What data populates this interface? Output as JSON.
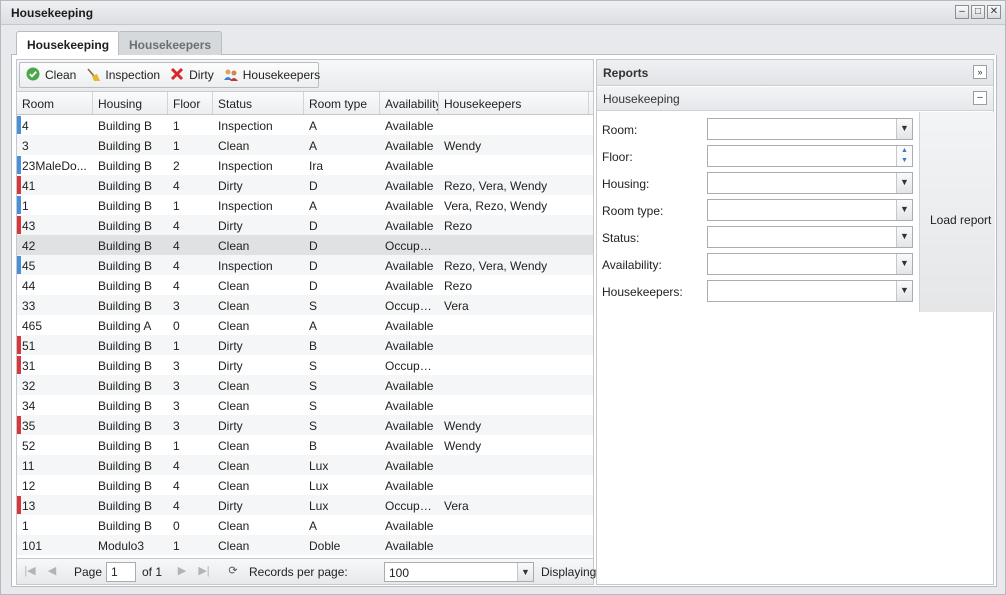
{
  "window": {
    "title": "Housekeeping",
    "buttons": [
      "–",
      "□",
      "✕"
    ]
  },
  "tabs": [
    {
      "label": "Housekeeping",
      "active": true
    },
    {
      "label": "Housekeepers",
      "active": false
    }
  ],
  "toolbar": {
    "clean": "Clean",
    "inspection": "Inspection",
    "dirty": "Dirty",
    "housekeepers": "Housekeepers"
  },
  "grid": {
    "columns": [
      "Room",
      "Housing",
      "Floor",
      "Status",
      "Room type",
      "Availability",
      "Housekeepers"
    ],
    "rows": [
      {
        "room": "4",
        "housing": "Building B",
        "floor": "1",
        "status": "Inspection",
        "type": "A",
        "avail": "Available",
        "hk": "",
        "marker": "#4a90d9"
      },
      {
        "room": "3",
        "housing": "Building B",
        "floor": "1",
        "status": "Clean",
        "type": "A",
        "avail": "Available",
        "hk": "Wendy",
        "marker": ""
      },
      {
        "room": "23MaleDo...",
        "housing": "Building B",
        "floor": "2",
        "status": "Inspection",
        "type": "Ira",
        "avail": "Available",
        "hk": "",
        "marker": "#4a90d9"
      },
      {
        "room": "41",
        "housing": "Building B",
        "floor": "4",
        "status": "Dirty",
        "type": "D",
        "avail": "Available",
        "hk": "Rezo, Vera, Wendy",
        "marker": "#d9363e"
      },
      {
        "room": "1",
        "housing": "Building B",
        "floor": "1",
        "status": "Inspection",
        "type": "A",
        "avail": "Available",
        "hk": "Vera, Rezo, Wendy",
        "marker": "#4a90d9"
      },
      {
        "room": "43",
        "housing": "Building B",
        "floor": "4",
        "status": "Dirty",
        "type": "D",
        "avail": "Available",
        "hk": "Rezo",
        "marker": "#d9363e"
      },
      {
        "room": "42",
        "housing": "Building B",
        "floor": "4",
        "status": "Clean",
        "type": "D",
        "avail": "Occupied",
        "hk": "",
        "marker": "",
        "selected": true
      },
      {
        "room": "45",
        "housing": "Building B",
        "floor": "4",
        "status": "Inspection",
        "type": "D",
        "avail": "Available",
        "hk": "Rezo, Vera, Wendy",
        "marker": "#4a90d9"
      },
      {
        "room": "44",
        "housing": "Building B",
        "floor": "4",
        "status": "Clean",
        "type": "D",
        "avail": "Available",
        "hk": "Rezo",
        "marker": ""
      },
      {
        "room": "33",
        "housing": "Building B",
        "floor": "3",
        "status": "Clean",
        "type": "S",
        "avail": "Occupied",
        "hk": "Vera",
        "marker": ""
      },
      {
        "room": "465",
        "housing": "Building A",
        "floor": "0",
        "status": "Clean",
        "type": "A",
        "avail": "Available",
        "hk": "",
        "marker": ""
      },
      {
        "room": "51",
        "housing": "Building B",
        "floor": "1",
        "status": "Dirty",
        "type": "B",
        "avail": "Available",
        "hk": "",
        "marker": "#d9363e"
      },
      {
        "room": "31",
        "housing": "Building B",
        "floor": "3",
        "status": "Dirty",
        "type": "S",
        "avail": "Occupied",
        "hk": "",
        "marker": "#d9363e"
      },
      {
        "room": "32",
        "housing": "Building B",
        "floor": "3",
        "status": "Clean",
        "type": "S",
        "avail": "Available",
        "hk": "",
        "marker": ""
      },
      {
        "room": "34",
        "housing": "Building B",
        "floor": "3",
        "status": "Clean",
        "type": "S",
        "avail": "Available",
        "hk": "",
        "marker": ""
      },
      {
        "room": "35",
        "housing": "Building B",
        "floor": "3",
        "status": "Dirty",
        "type": "S",
        "avail": "Available",
        "hk": "Wendy",
        "marker": "#d9363e"
      },
      {
        "room": "52",
        "housing": "Building B",
        "floor": "1",
        "status": "Clean",
        "type": "B",
        "avail": "Available",
        "hk": "Wendy",
        "marker": ""
      },
      {
        "room": "11",
        "housing": "Building B",
        "floor": "4",
        "status": "Clean",
        "type": "Lux",
        "avail": "Available",
        "hk": "",
        "marker": ""
      },
      {
        "room": "12",
        "housing": "Building B",
        "floor": "4",
        "status": "Clean",
        "type": "Lux",
        "avail": "Available",
        "hk": "",
        "marker": ""
      },
      {
        "room": "13",
        "housing": "Building B",
        "floor": "4",
        "status": "Dirty",
        "type": "Lux",
        "avail": "Occupied",
        "hk": "Vera",
        "marker": "#d9363e"
      },
      {
        "room": "1",
        "housing": "Building B",
        "floor": "0",
        "status": "Clean",
        "type": "A",
        "avail": "Available",
        "hk": "",
        "marker": ""
      },
      {
        "room": "101",
        "housing": "Modulo3",
        "floor": "1",
        "status": "Clean",
        "type": "Doble",
        "avail": "Available",
        "hk": "",
        "marker": ""
      }
    ]
  },
  "pager": {
    "page_label": "Page",
    "page_value": "1",
    "of_label": "of 1",
    "records_label": "Records per page:",
    "records_value": "100",
    "displaying": "Displaying"
  },
  "reports": {
    "title": "Reports",
    "section": "Housekeeping",
    "fields": [
      "Room:",
      "Floor:",
      "Housing:",
      "Room type:",
      "Status:",
      "Availability:",
      "Housekeepers:"
    ],
    "load_button": "Load report"
  }
}
